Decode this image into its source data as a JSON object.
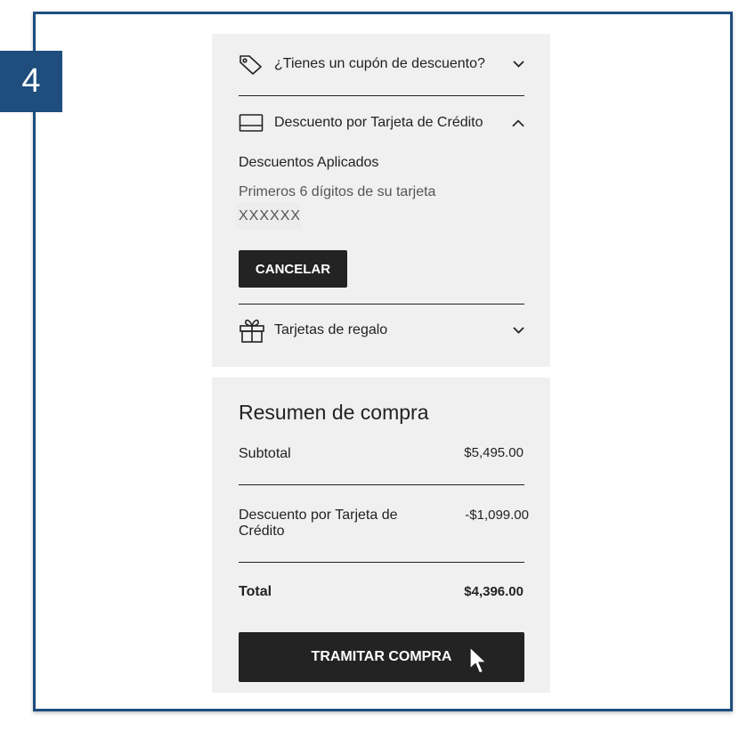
{
  "step": {
    "number": "4"
  },
  "accordions": {
    "coupon": {
      "label": "¿Tienes un cupón de descuento?",
      "icon": "tag-icon",
      "expanded": false
    },
    "credit_card": {
      "label": "Descuento por Tarjeta de Crédito",
      "icon": "credit-card-icon",
      "expanded": true,
      "applied_title": "Descuentos Aplicados",
      "digits_label": "Primeros 6 dígitos de su tarjeta",
      "digits_value": "XXXXXX",
      "cancel_label": "CANCELAR"
    },
    "gift_cards": {
      "label": "Tarjetas de regalo",
      "icon": "gift-icon",
      "expanded": false
    }
  },
  "summary": {
    "title": "Resumen de compra",
    "subtotal_label": "Subtotal",
    "subtotal_value": "$5,495.00",
    "discount_label": "Descuento por Tarjeta de Crédito",
    "discount_value": "-$1,099.00",
    "total_label": "Total",
    "total_value": "$4,396.00",
    "checkout_label": "TRAMITAR COMPRA"
  },
  "colors": {
    "frame": "#1f4e7e",
    "panel": "#f0f0f0",
    "button": "#232323"
  }
}
